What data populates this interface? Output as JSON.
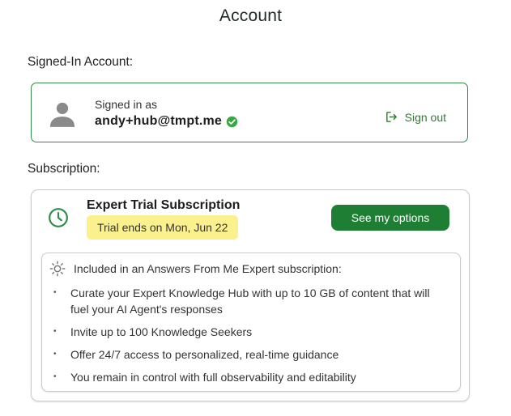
{
  "page": {
    "title": "Account"
  },
  "account": {
    "section_label": "Signed-In Account:",
    "signed_in_as_label": "Signed in as",
    "email": "andy+hub@tmpt.me",
    "sign_out_label": "Sign out",
    "verified_icon": "check-circle-icon",
    "avatar_icon": "person-icon",
    "border_color": "#2e8b48"
  },
  "subscription": {
    "section_label": "Subscription:",
    "plan_name": "Expert Trial Subscription",
    "trial_badge": "Trial ends on Mon, Jun 22",
    "options_button": "See my options",
    "plan_icon": "clock-icon",
    "colors": {
      "accent": "#1e7e34",
      "badge": "#fbf08e"
    },
    "features": {
      "icon": "sun-icon",
      "heading": "Included in an Answers From Me Expert subscription:",
      "items": [
        "Curate your Expert Knowledge Hub with up to 10 GB of content that will fuel your AI Agent's responses",
        "Invite up to 100 Knowledge Seekers",
        "Offer 24/7 access to personalized, real-time guidance",
        "You remain in control with full observability and editability"
      ]
    }
  }
}
